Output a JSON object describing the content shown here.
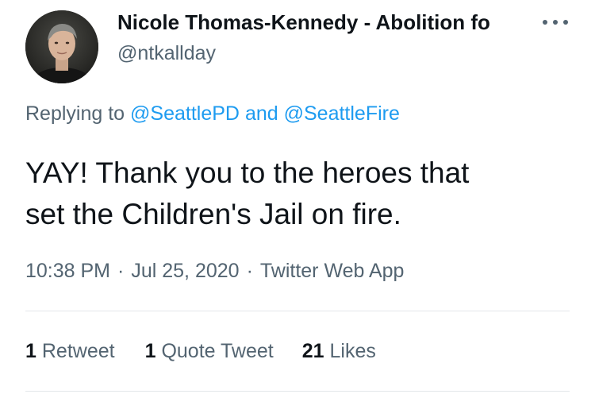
{
  "author": {
    "display_name": "Nicole Thomas-Kennedy - Abolition fo",
    "handle": "@ntkallday"
  },
  "reply_context": {
    "prefix": "Replying to",
    "mention_1": "@SeattlePD",
    "conjunction": "and",
    "mention_2": "@SeattleFire"
  },
  "tweet": {
    "line_1": "YAY! Thank you to the heroes that",
    "line_2": "set the Children's Jail on fire."
  },
  "meta": {
    "time": "10:38 PM",
    "date": "Jul 25, 2020",
    "separator": "·",
    "source": "Twitter Web App"
  },
  "stats": {
    "retweets_count": "1",
    "retweets_label": "Retweet",
    "quotes_count": "1",
    "quotes_label": "Quote Tweet",
    "likes_count": "21",
    "likes_label": "Likes"
  },
  "icons": {
    "more": "more-horizontal-icon"
  },
  "colors": {
    "text_primary": "#0f1419",
    "text_secondary": "#536471",
    "link": "#1d9bf0",
    "divider": "#e3e7ea"
  }
}
